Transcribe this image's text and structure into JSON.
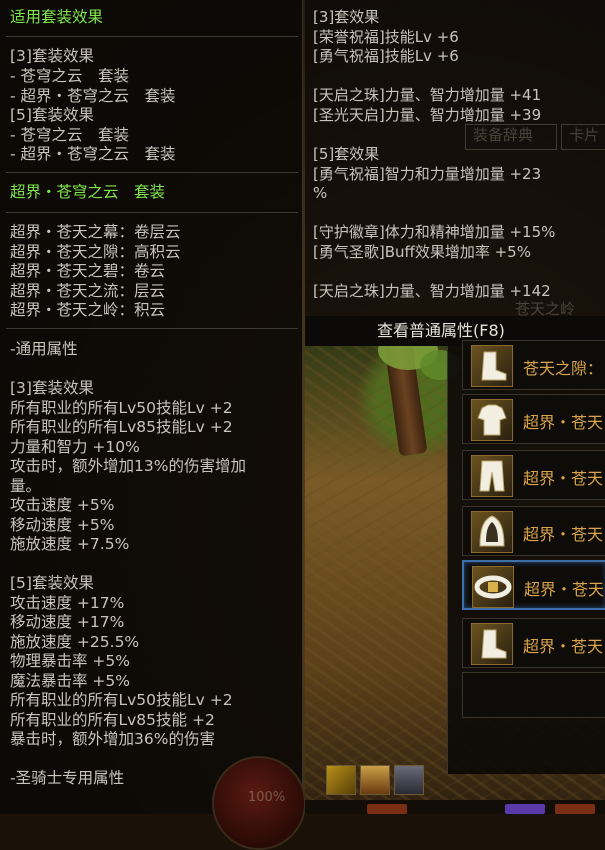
{
  "left_panel": {
    "title": "适用套装效果",
    "set3_header": "[3]套装效果",
    "set3_item1": "- 苍穹之云　套装",
    "set3_item2": "- 超界・苍穹之云　套装",
    "set5_header": "[5]套装效果",
    "set5_item1": "- 苍穹之云　套装",
    "set5_item2": "- 超界・苍穹之云　套装",
    "set_name": "超界・苍穹之云　套装",
    "pieces": [
      "超界・苍天之幕：卷层云",
      "超界・苍天之隙：高积云",
      "超界・苍天之碧：卷云",
      "超界・苍天之流：层云",
      "超界・苍天之岭：积云"
    ],
    "common_header": "-通用属性",
    "common3_header": "[3]套装效果",
    "common3": [
      "所有职业的所有Lv50技能Lv +2",
      "所有职业的所有Lv85技能Lv +2",
      "力量和智力 +10%",
      "攻击时，额外增加13%的伤害增加",
      "量。",
      "攻击速度 +5%",
      "移动速度 +5%",
      "施放速度 +7.5%"
    ],
    "common5_header": "[5]套装效果",
    "common5": [
      "攻击速度 +17%",
      "移动速度 +17%",
      "施放速度 +25.5%",
      "物理暴击率 +5%",
      "魔法暴击率 +5%",
      "所有职业的所有Lv50技能Lv +2",
      "所有职业的所有Lv85技能 +2",
      "暴击时，额外增加36%的伤害"
    ],
    "paladin_header": "-圣骑士专用属性",
    "orb_value": "100%"
  },
  "right_panel": {
    "lines": [
      "[3]套效果",
      "[荣誉祝福]技能Lv +6",
      "[勇气祝福]技能Lv +6",
      "",
      "[天启之珠]力量、智力增加量 +41",
      "[圣光天启]力量、智力增加量 +39",
      "",
      "[5]套效果",
      "[勇气祝福]智力和力量增加量 +23",
      "%",
      "",
      "[守护徽章]体力和精神增加量 +15%",
      "[勇气圣歌]Buff效果增加率 +5%",
      "",
      "[天启之珠]力量、智力增加量 +142"
    ],
    "ghost_tab1": "装备辞典",
    "ghost_tab2": "卡片",
    "ghost_word": "苍天之岭",
    "f8_label": "查看普通属性(F8)"
  },
  "equipment": {
    "items": [
      {
        "name": "苍天之隙："
      },
      {
        "name": "超界・苍天"
      },
      {
        "name": "超界・苍天"
      },
      {
        "name": "超界・苍天"
      },
      {
        "name": "超界・苍天"
      },
      {
        "name": "超界・苍天"
      }
    ],
    "selected_index": 4
  },
  "colors": {
    "set_green": "#7fe84c",
    "text_gray": "#c8c4bc",
    "item_gold": "#d8a44c",
    "selection_blue": "#3e6fa8"
  },
  "icons": [
    "boots-icon",
    "top-armor-icon",
    "pants-icon",
    "shoulder-icon",
    "belt-icon",
    "boots-icon"
  ]
}
